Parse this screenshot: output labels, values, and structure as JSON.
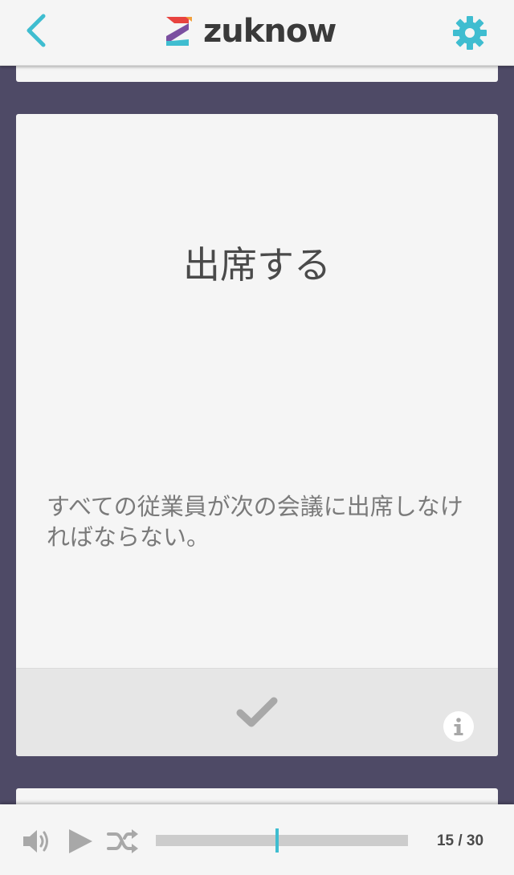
{
  "app": {
    "brand_name": "zuknow",
    "accent_color": "#3fbdd0",
    "background_color": "#4e4a66"
  },
  "header": {
    "back_icon": "chevron-left-icon",
    "settings_icon": "gear-icon"
  },
  "card": {
    "word": "出席する",
    "sentence": "すべての従業員が次の会議に出席しなければならない。",
    "check_icon": "checkmark-icon",
    "info_icon": "info-icon"
  },
  "player": {
    "volume_icon": "speaker-icon",
    "play_icon": "play-icon",
    "shuffle_icon": "shuffle-icon",
    "current": 15,
    "total": 30,
    "counter_text": "15 / 30",
    "progress_fraction": 0.48
  }
}
